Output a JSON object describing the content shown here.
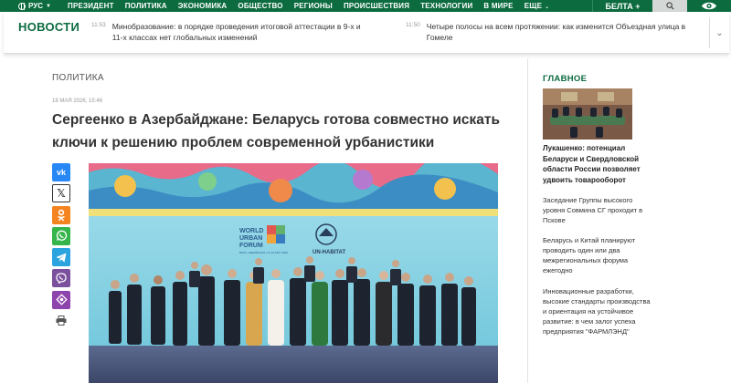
{
  "topnav": {
    "lang": "РУС",
    "items": [
      "ПРЕЗИДЕНТ",
      "ПОЛИТИКА",
      "ЭКОНОМИКА",
      "ОБЩЕСТВО",
      "РЕГИОНЫ",
      "ПРОИСШЕСТВИЯ",
      "ТЕХНОЛОГИИ",
      "В МИРЕ",
      "ЕЩЕ"
    ],
    "brand": "БЕЛТА +",
    "colors": {
      "nav_bg": "#0c6b3f",
      "search_bg": "#d4d8d6"
    }
  },
  "news_strip": {
    "label": "НОВОСТИ",
    "items": [
      {
        "time": "11:53",
        "text": "Минобразование: в порядке проведения итоговой аттестации в 9-х и 11-х классах нет глобальных изменений"
      },
      {
        "time": "11:50",
        "text": "Четыре полосы на всем протяжении: как изменится Объездная улица в Гомеле"
      }
    ]
  },
  "article": {
    "category": "ПОЛИТИКА",
    "date": "18 МАЯ 2026, 15:46",
    "headline": "Сергеенко в Азербайджане: Беларусь готова совместно искать ключи к решению проблем современной урбанистики",
    "share_icons": [
      "vk-icon",
      "x-icon",
      "ok-icon",
      "whatsapp-icon",
      "telegram-icon",
      "viber-icon",
      "max-icon"
    ],
    "photo_logos": {
      "forum": "WORLD URBAN FORUM",
      "forum_sub": "BAKU, AZERBAIJAN | 17-22 MAY 2026",
      "unhabitat": "UN-HABITAT"
    }
  },
  "sidebar": {
    "title": "ГЛАВНОЕ",
    "lead": "Лукашенко: потенциал Беларуси и Свердловской области России позволяет удвоить товарооборот",
    "items": [
      "Заседание Группы высокого уровня Совмина СГ проходит в Пскове",
      "Беларусь и Китай планируют проводить один или два межрегиональных форума ежегодно",
      "Инновационные разработки, высокие стандарты производства и ориентация на устойчивое развитие: в чем залог успеха предприятия \"ФАРМЛЭНД\""
    ]
  }
}
